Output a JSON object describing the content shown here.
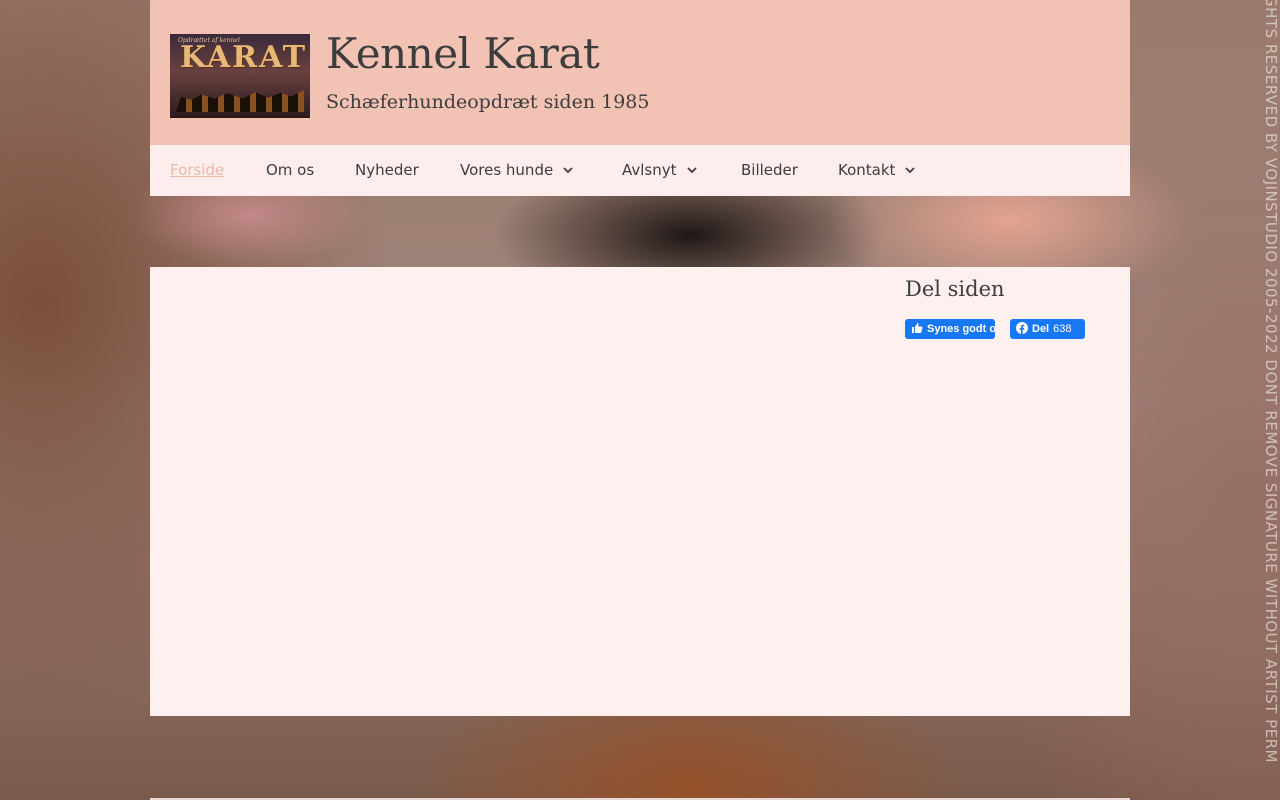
{
  "watermark": "GHTS RESERVED BY VOJINSTUDIO 2005-2022 DONT REMOVE SIGNATURE WITHOUT ARTIST PERM",
  "header": {
    "logo_text": "KARAT",
    "logo_subtext": "Opdrættet af kennel",
    "title": "Kennel Karat",
    "tagline": "Schæferhundeopdræt siden 1985"
  },
  "nav": {
    "items": [
      {
        "label": "Forside",
        "active": true,
        "has_dropdown": false
      },
      {
        "label": "Om os",
        "active": false,
        "has_dropdown": false
      },
      {
        "label": "Nyheder",
        "active": false,
        "has_dropdown": false
      },
      {
        "label": "Vores hunde",
        "active": false,
        "has_dropdown": true
      },
      {
        "label": "Avlsnyt",
        "active": false,
        "has_dropdown": true
      },
      {
        "label": "Billeder",
        "active": false,
        "has_dropdown": false
      },
      {
        "label": "Kontakt",
        "active": false,
        "has_dropdown": true
      }
    ]
  },
  "sidebar": {
    "widget_title": "Del siden",
    "like_label": "Synes godt om",
    "share_label": "Del",
    "share_count": "638"
  },
  "colors": {
    "header_bg": "#f2c3b5",
    "nav_bg": "#fdeeed",
    "content_bg": "#fdf0ef",
    "active_link": "#f0b8a8",
    "text": "#3d3d3d",
    "facebook_blue": "#1877f2"
  },
  "icons": {
    "dropdown": "chevron-down-icon",
    "like": "thumbs-up-icon",
    "share": "facebook-icon"
  }
}
